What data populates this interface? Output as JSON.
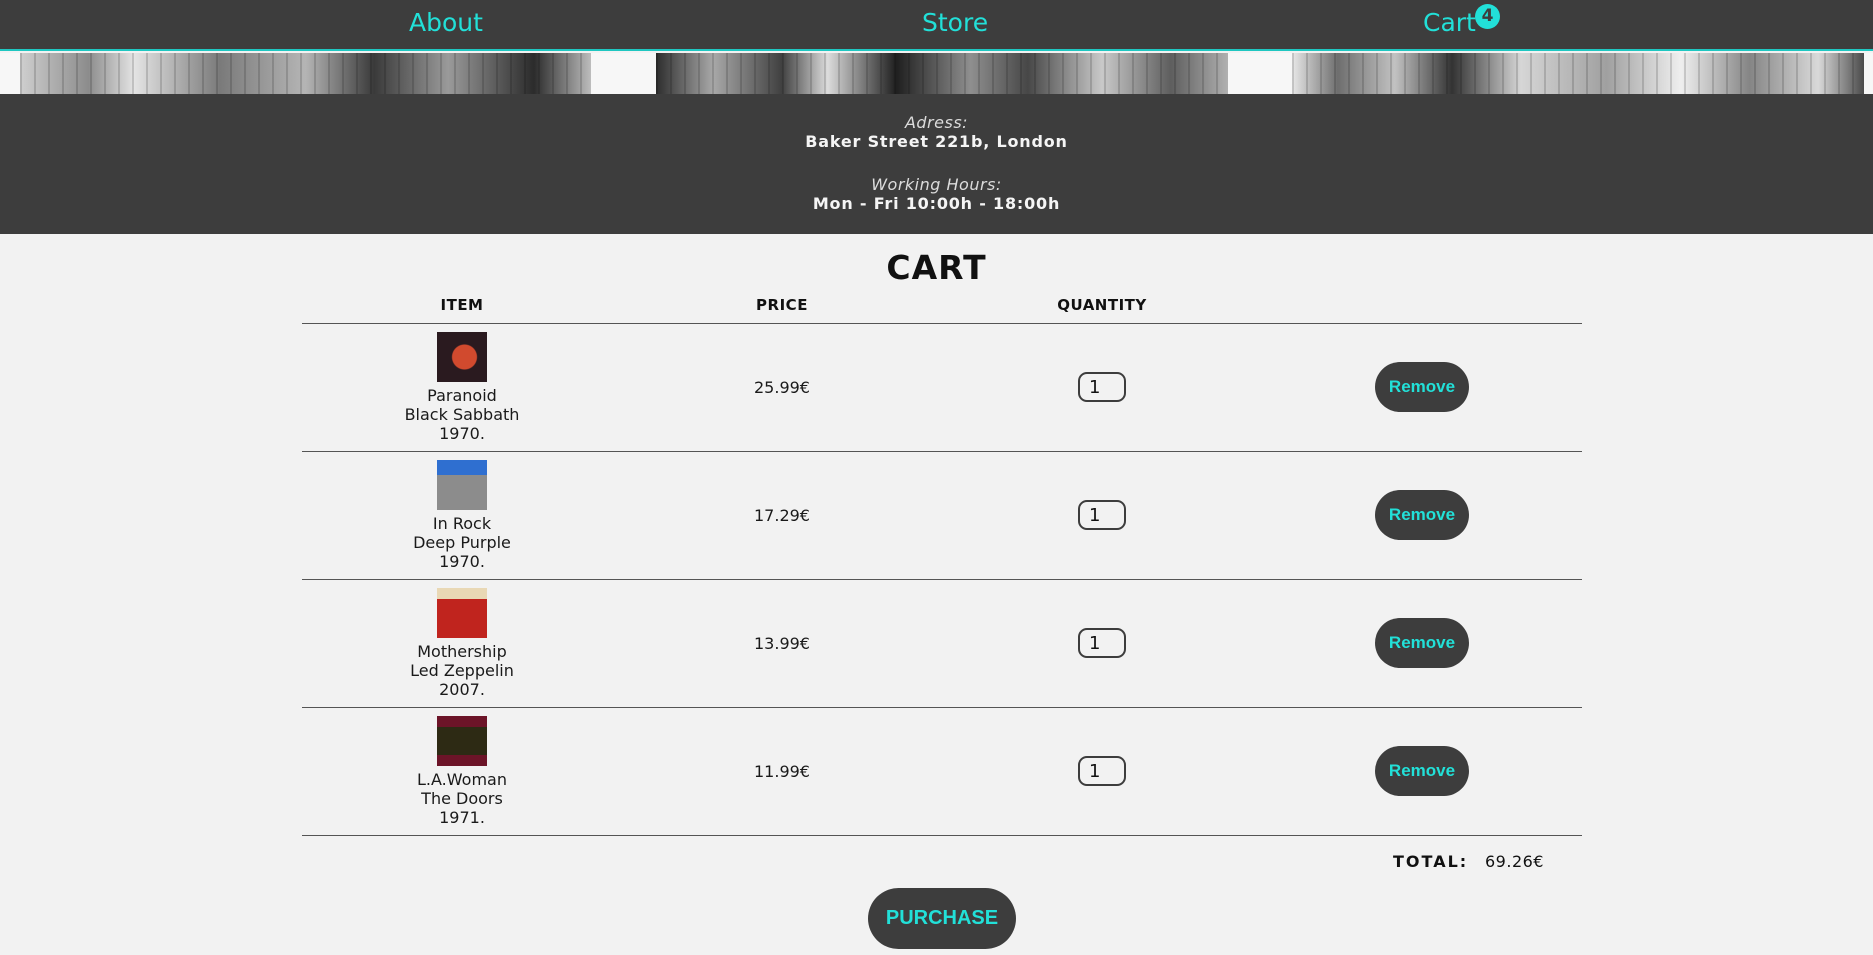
{
  "nav": {
    "about": "About",
    "store": "Store",
    "cart": "Cart",
    "cart_count": "4"
  },
  "info": {
    "address_label": "Adress:",
    "address_value": "Baker Street 221b, London",
    "hours_label": "Working Hours:",
    "hours_value": "Mon - Fri 10:00h - 18:00h"
  },
  "cart": {
    "title": "CART",
    "headers": {
      "item": "ITEM",
      "price": "PRICE",
      "quantity": "QUANTITY"
    },
    "items": [
      {
        "title": "Paranoid",
        "artist": "Black Sabbath",
        "year": "1970.",
        "price": "25.99€",
        "quantity": "1",
        "remove": "Remove"
      },
      {
        "title": "In Rock",
        "artist": "Deep Purple",
        "year": "1970.",
        "price": "17.29€",
        "quantity": "1",
        "remove": "Remove"
      },
      {
        "title": "Mothership",
        "artist": "Led Zeppelin",
        "year": "2007.",
        "price": "13.99€",
        "quantity": "1",
        "remove": "Remove"
      },
      {
        "title": "L.A.Woman",
        "artist": "The Doors",
        "year": "1971.",
        "price": "11.99€",
        "quantity": "1",
        "remove": "Remove"
      }
    ],
    "total_label": "TOTAL:",
    "total_value": "69.26€",
    "purchase": "PURCHASE"
  },
  "colors": {
    "dark": "#3d3d3d",
    "accent": "#22e0d8",
    "background": "#f2f2f2"
  }
}
